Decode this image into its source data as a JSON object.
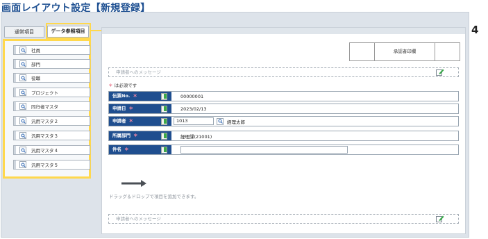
{
  "page": {
    "title": "画面レイアウト設定【新規登録】"
  },
  "tabs": [
    {
      "label": "通常項目",
      "active": false
    },
    {
      "label": "データ参照項目",
      "active": true
    }
  ],
  "sidebar": {
    "items": [
      {
        "label": "社員"
      },
      {
        "label": "部門"
      },
      {
        "label": "役職"
      },
      {
        "label": "プロジェクト"
      },
      {
        "label": "同行者マスタ"
      },
      {
        "label": "汎用マスタ２"
      },
      {
        "label": "汎用マスタ３"
      },
      {
        "label": "汎用マスタ４"
      },
      {
        "label": "汎用マスタ５"
      }
    ]
  },
  "approval": {
    "label": "承認者印欄"
  },
  "messages": {
    "top_placeholder": "申請者へのメッセージ",
    "bottom_placeholder": "申請者へのメッセージ"
  },
  "required_note": {
    "star": "＊",
    "text": "は必須です"
  },
  "form": {
    "star": "＊",
    "fields": [
      {
        "label": "伝票No.",
        "value": "00000001"
      },
      {
        "label": "申請日",
        "value": "2023/02/13"
      },
      {
        "label": "申請者",
        "code": "1013",
        "name": "経理太郎"
      },
      {
        "label": "所属部門",
        "value": "経理課(21001)"
      },
      {
        "label": "件名",
        "value": ""
      }
    ]
  },
  "drag_hint": "ドラッグ＆ドロップで項目を追加できます。",
  "callout": {
    "number": "4"
  },
  "colors": {
    "title": "#1d4f91",
    "label_bg": "#1f4e8f",
    "highlight": "#ffd84d",
    "required": "#e0405e"
  }
}
